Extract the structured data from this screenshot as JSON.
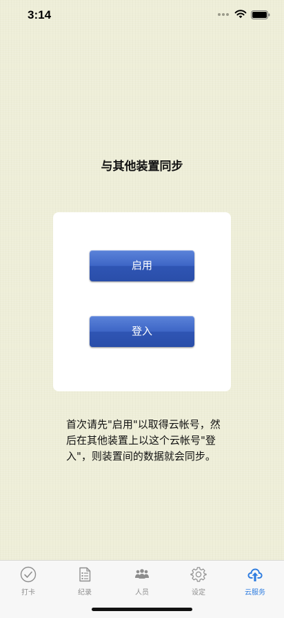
{
  "status_bar": {
    "time": "3:14"
  },
  "page": {
    "title": "与其他装置同步",
    "instructions": "首次请先\"启用\"以取得云帐号，然后在其他装置上以这个云帐号\"登入\"，则装置间的数据就会同步。"
  },
  "card": {
    "enable_button": "启用",
    "login_button": "登入"
  },
  "tab_bar": {
    "tabs": [
      {
        "label": "打卡",
        "icon": "checkmark-circle-icon",
        "active": false
      },
      {
        "label": "纪录",
        "icon": "document-list-icon",
        "active": false
      },
      {
        "label": "人员",
        "icon": "people-group-icon",
        "active": false
      },
      {
        "label": "设定",
        "icon": "gear-icon",
        "active": false
      },
      {
        "label": "云服务",
        "icon": "cloud-upload-icon",
        "active": true
      }
    ]
  },
  "colors": {
    "background": "#eeeed8",
    "button": "#3e66c6",
    "active_tab": "#2f7de0",
    "inactive_tab": "#8e8e8e"
  }
}
